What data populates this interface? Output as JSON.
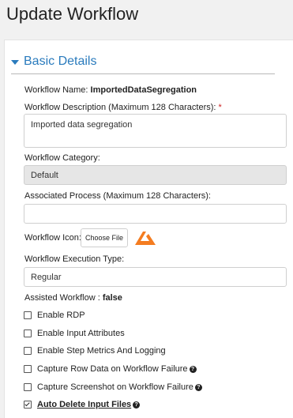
{
  "page": {
    "title": "Update Workflow"
  },
  "section": {
    "title": "Basic Details"
  },
  "form": {
    "workflow_name_label": "Workflow Name: ",
    "workflow_name_value": "ImportedDataSegregation",
    "description_label": "Workflow Description (Maximum 128 Characters): ",
    "required_mark": "*",
    "description_value": "Imported data segregation",
    "category_label": "Workflow Category:",
    "category_value": "Default",
    "process_label": "Associated Process (Maximum 128 Characters):",
    "process_value": "",
    "icon_label": "Workflow Icon:",
    "choose_file_label": "Choose File",
    "execution_type_label": "Workflow Execution Type:",
    "execution_type_value": "Regular",
    "assisted_label": "Assisted Workflow : ",
    "assisted_value": "false"
  },
  "checkboxes": [
    {
      "label": "Enable RDP",
      "checked": false,
      "help": false
    },
    {
      "label": "Enable Input Attributes",
      "checked": false,
      "help": false
    },
    {
      "label": "Enable Step Metrics And Logging",
      "checked": false,
      "help": false
    },
    {
      "label": "Capture Row Data on Workflow Failure",
      "checked": false,
      "help": true
    },
    {
      "label": "Capture Screenshot on Workflow Failure",
      "checked": false,
      "help": true
    },
    {
      "label": "Auto Delete Input Files",
      "checked": true,
      "help": true
    }
  ],
  "colors": {
    "accent": "#2a7bbd",
    "logo": "#f47c20",
    "required": "#cc2222"
  }
}
